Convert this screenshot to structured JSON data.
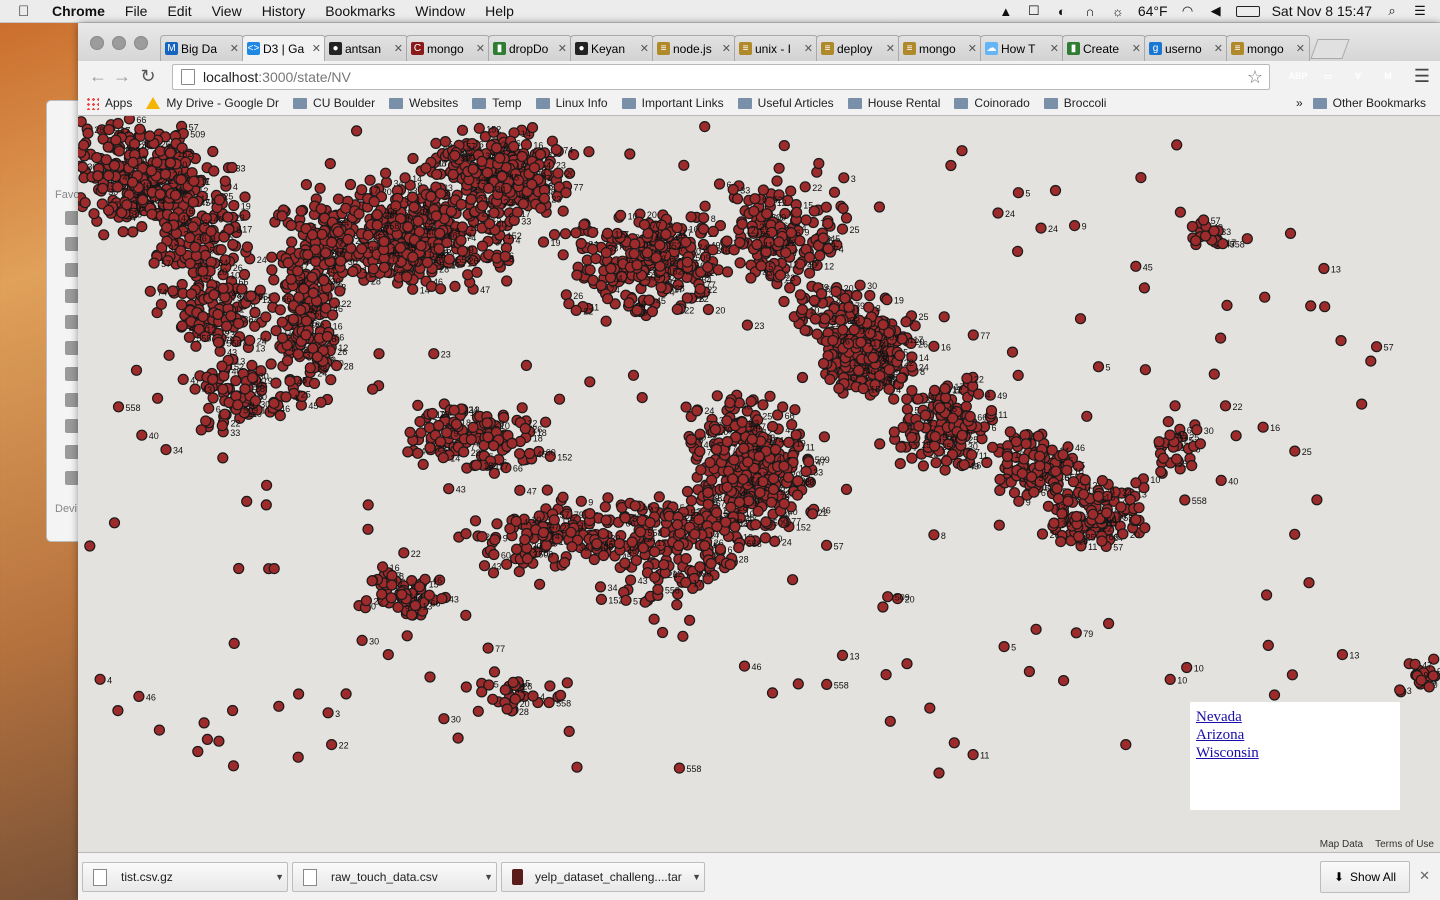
{
  "menubar": {
    "app_name": "Chrome",
    "items": [
      "File",
      "Edit",
      "View",
      "History",
      "Bookmarks",
      "Window",
      "Help"
    ],
    "weather": "64°F",
    "clock": "Sat Nov 8  15:47"
  },
  "finder": {
    "favorites_label": "Favo",
    "devices_label": "Devi"
  },
  "tabs": [
    {
      "label": "Big Da",
      "color": "#1565c0",
      "glyph": "M"
    },
    {
      "label": "D3 | Ga",
      "color": "#1e88e5",
      "glyph": "<>"
    },
    {
      "label": "antsan",
      "color": "#222222",
      "glyph": "●"
    },
    {
      "label": "mongo",
      "color": "#8b1a1a",
      "glyph": "C"
    },
    {
      "label": "dropDo",
      "color": "#2e7d32",
      "glyph": "▮"
    },
    {
      "label": "Keyan",
      "color": "#222222",
      "glyph": "●"
    },
    {
      "label": "node.js",
      "color": "#b08a2a",
      "glyph": "≡"
    },
    {
      "label": "unix - I",
      "color": "#b08a2a",
      "glyph": "≡"
    },
    {
      "label": "deploy",
      "color": "#b08a2a",
      "glyph": "≡"
    },
    {
      "label": "mongo",
      "color": "#b08a2a",
      "glyph": "≡"
    },
    {
      "label": "How T",
      "color": "#64b5f6",
      "glyph": "☁"
    },
    {
      "label": "Create",
      "color": "#2e7d32",
      "glyph": "▮"
    },
    {
      "label": "userno",
      "color": "#1976d2",
      "glyph": "g"
    },
    {
      "label": "mongo",
      "color": "#b08a2a",
      "glyph": "≡"
    }
  ],
  "active_tab_index": 1,
  "address": {
    "host": "localhost",
    "path": ":3000/state/NV"
  },
  "extensions": [
    {
      "label": "ABP",
      "color": "#d32f2f"
    },
    {
      "label": "▭",
      "color": "#9e9e9e"
    },
    {
      "label": "V",
      "color": "#29b6f6"
    },
    {
      "label": "M",
      "color": "#26c6da"
    }
  ],
  "bookmarks": {
    "apps": "Apps",
    "drive": "My Drive - Google Dr",
    "folders": [
      "CU Boulder",
      "Websites",
      "Temp",
      "Linux Info",
      "Important Links",
      "Useful Articles",
      "House Rental",
      "Coinorado",
      "Broccoli"
    ],
    "overflow": "»",
    "other": "Other Bookmarks"
  },
  "map": {
    "marker_color": "#9e2b2b",
    "marker_stroke": "#1a1a1a",
    "label_samples": [
      "3",
      "4",
      "5",
      "6",
      "8",
      "9",
      "10",
      "11",
      "12",
      "13",
      "14",
      "15",
      "16",
      "17",
      "18",
      "19",
      "20",
      "22",
      "23",
      "24",
      "25",
      "26",
      "28",
      "30",
      "33",
      "34",
      "40",
      "43",
      "45",
      "46",
      "47",
      "49",
      "57",
      "60",
      "66",
      "74",
      "77",
      "79",
      "117",
      "152",
      "509",
      "558"
    ],
    "legend_links": [
      "Nevada",
      "Arizona",
      "Wisconsin"
    ],
    "footer": [
      "Map Data",
      "Terms of Use"
    ]
  },
  "downloads": {
    "items": [
      "tist.csv.gz",
      "raw_touch_data.csv",
      "yelp_dataset_challeng....tar"
    ],
    "show_all": "Show All"
  }
}
